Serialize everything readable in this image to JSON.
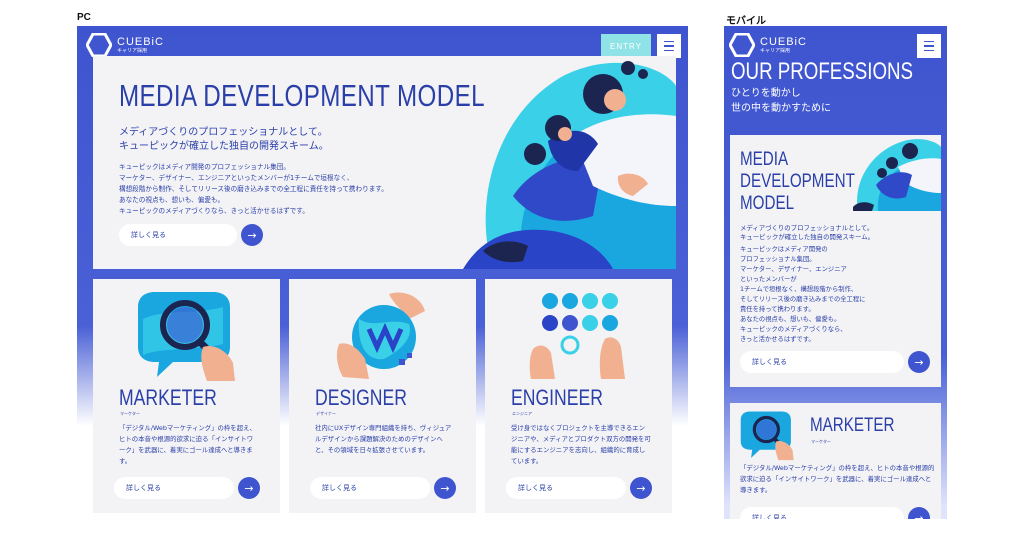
{
  "labels": {
    "pc": "PC",
    "mobile": "モバイル"
  },
  "brand": {
    "name": "CUEBiC",
    "sub": "キャリア採用"
  },
  "header": {
    "entry_label": "ENTRY"
  },
  "colors": {
    "primary": "#3f55cf",
    "accent": "#8fe3e6",
    "text": "#2a3fa8",
    "card": "#f3f3f6"
  },
  "icons": [
    "cuebic-logo-icon",
    "menu-icon",
    "arrow-right-icon",
    "magnifier-chat-icon",
    "globe-hand-icon",
    "nodes-hands-icon"
  ],
  "more_label": "詳しく見る",
  "more_arrow": "→",
  "hero": {
    "title": "MEDIA DEVELOPMENT MODEL",
    "lead": "メディアづくりのプロフェッショナルとして。\nキューピックが確立した独自の開発スキーム。",
    "body": "キューピックはメディア開発のプロフェッショナル集団。\nマーケター、デザイナー、エンジニアといったメンバーが1チームで垣根なく、\n構想段階から制作、そしてリリース後の磨き込みまでの全工程に責任を持って携わります。\nあなたの視点も、想いも、偏愛も。\nキューピックのメディアづくりなら、きっと活かせるはずです。"
  },
  "cards": [
    {
      "title": "MARKETER",
      "sub": "マーケター",
      "desc": "「デジタル/Webマーケティング」の枠を超え、ヒトの本音や根源的欲求に迫る「インサイトワーク」を武器に、着実にゴール達成へと導きます。"
    },
    {
      "title": "DESIGNER",
      "sub": "デザイナー",
      "desc": "社内にUXデザイン専門組織を持ち、ヴィジュアルデザインから課題解決のためのデザインへと、その領域を日々拡張させています。"
    },
    {
      "title": "ENGINEER",
      "sub": "エンジニア",
      "desc": "受け身ではなくプロジェクトを主導できるエンジニアや、メディアとプロダクト双方の開発を可能にするエンジニアを志向し、組織的に育成しています。"
    }
  ],
  "mobile": {
    "title": "OUR PROFESSIONS",
    "subtitle": "ひとりを動かし\n世の中を動かすために",
    "card1": {
      "title": "MEDIA\nDEVELOPMENT\nMODEL",
      "lead": "メディアづくりのプロフェッショナルとして。\nキューピックが確立した独自の開発スキーム。",
      "body": "キューピックはメディア開発の\nプロフェッショナル集団。\nマーケター、デザイナー、エンジニア\nといったメンバーが\n1チームで垣根なく、構想段階から制作、\nそしてリリース後の磨き込みまでの全工程に\n責任を持って携わります。\nあなたの視点も、想いも、偏愛も。\nキューピックのメディアづくりなら、\nきっと活かせるはずです。"
    },
    "card2": {
      "title": "MARKETER",
      "sub": "マーケター",
      "desc": "「デジタル/Webマーケティング」の枠を超え、ヒトの本音や根源的欲求に迫る「インサイトワーク」を武器に、着実にゴール達成へと導きます。"
    }
  }
}
